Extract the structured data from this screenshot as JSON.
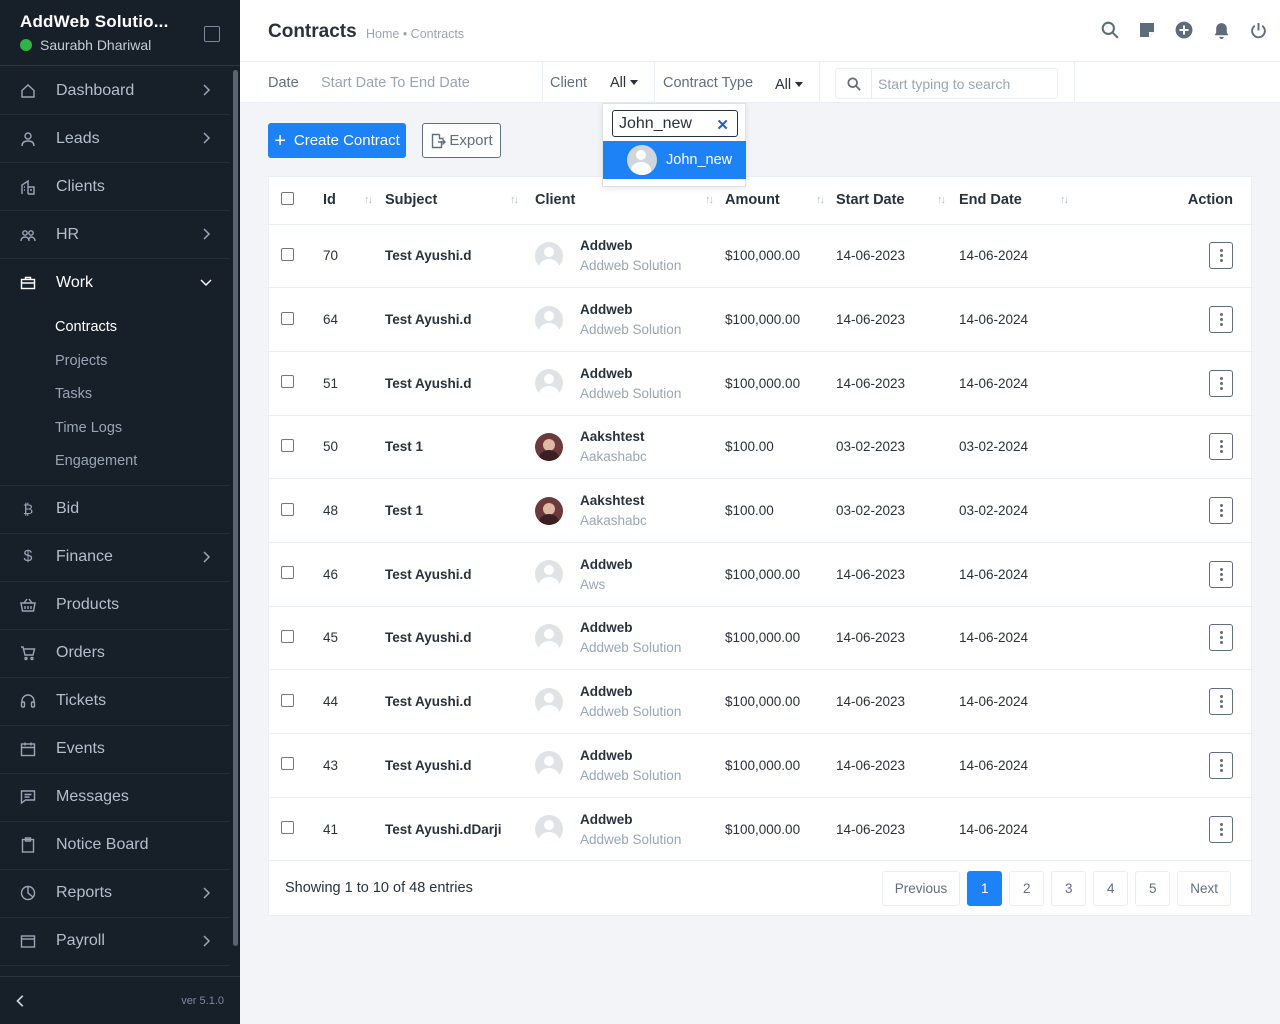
{
  "sidebar": {
    "brand": "AddWeb Solutio...",
    "user": "Saurabh Dhariwal",
    "version": "ver 5.1.0",
    "items": [
      {
        "label": "Dashboard",
        "icon": "house-icon"
      },
      {
        "label": "Leads",
        "icon": "user-icon"
      },
      {
        "label": "Clients",
        "icon": "building-icon"
      },
      {
        "label": "HR",
        "icon": "people-icon"
      },
      {
        "label": "Work",
        "icon": "briefcase-icon"
      },
      {
        "label": "Bid",
        "icon": "bitcoin-icon"
      },
      {
        "label": "Finance",
        "icon": "dollar-icon"
      },
      {
        "label": "Products",
        "icon": "basket-icon"
      },
      {
        "label": "Orders",
        "icon": "cart-icon"
      },
      {
        "label": "Tickets",
        "icon": "headset-icon"
      },
      {
        "label": "Events",
        "icon": "calendar-icon"
      },
      {
        "label": "Messages",
        "icon": "chat-icon"
      },
      {
        "label": "Notice Board",
        "icon": "clipboard-icon"
      },
      {
        "label": "Reports",
        "icon": "pie-chart-icon"
      },
      {
        "label": "Payroll",
        "icon": "wallet-icon"
      }
    ],
    "work_sub": [
      "Contracts",
      "Projects",
      "Tasks",
      "Time Logs",
      "Engagement"
    ]
  },
  "header": {
    "title": "Contracts",
    "breadcrumb": "Home • Contracts"
  },
  "filters": {
    "date_label": "Date",
    "date_placeholder": "Start Date To End Date",
    "client_label": "Client",
    "client_value": "All",
    "type_label": "Contract Type",
    "type_value": "All",
    "search_placeholder": "Start typing to search"
  },
  "dropdown": {
    "search_value": "John_new",
    "option": "John_new"
  },
  "actions": {
    "create": "Create Contract",
    "export": "Export"
  },
  "table": {
    "columns": [
      "Id",
      "Subject",
      "Client",
      "Amount",
      "Start Date",
      "End Date",
      "Action"
    ],
    "rows": [
      {
        "id": "70",
        "subject": "Test Ayushi.d",
        "client": "Addweb",
        "company": "Addweb Solution",
        "amount": "$100,000.00",
        "start": "14-06-2023",
        "end": "14-06-2024"
      },
      {
        "id": "64",
        "subject": "Test Ayushi.d",
        "client": "Addweb",
        "company": "Addweb Solution",
        "amount": "$100,000.00",
        "start": "14-06-2023",
        "end": "14-06-2024"
      },
      {
        "id": "51",
        "subject": "Test Ayushi.d",
        "client": "Addweb",
        "company": "Addweb Solution",
        "amount": "$100,000.00",
        "start": "14-06-2023",
        "end": "14-06-2024"
      },
      {
        "id": "50",
        "subject": "Test 1",
        "client": "Aakshtest",
        "company": "Aakashabc",
        "amount": "$100.00",
        "start": "03-02-2023",
        "end": "03-02-2024"
      },
      {
        "id": "48",
        "subject": "Test 1",
        "client": "Aakshtest",
        "company": "Aakashabc",
        "amount": "$100.00",
        "start": "03-02-2023",
        "end": "03-02-2024"
      },
      {
        "id": "46",
        "subject": "Test Ayushi.d",
        "client": "Addweb",
        "company": "Aws",
        "amount": "$100,000.00",
        "start": "14-06-2023",
        "end": "14-06-2024"
      },
      {
        "id": "45",
        "subject": "Test Ayushi.d",
        "client": "Addweb",
        "company": "Addweb Solution",
        "amount": "$100,000.00",
        "start": "14-06-2023",
        "end": "14-06-2024"
      },
      {
        "id": "44",
        "subject": "Test Ayushi.d",
        "client": "Addweb",
        "company": "Addweb Solution",
        "amount": "$100,000.00",
        "start": "14-06-2023",
        "end": "14-06-2024"
      },
      {
        "id": "43",
        "subject": "Test Ayushi.d",
        "client": "Addweb",
        "company": "Addweb Solution",
        "amount": "$100,000.00",
        "start": "14-06-2023",
        "end": "14-06-2024"
      },
      {
        "id": "41",
        "subject": "Test Ayushi.dDarji",
        "client": "Addweb",
        "company": "Addweb Solution",
        "amount": "$100,000.00",
        "start": "14-06-2023",
        "end": "14-06-2024"
      }
    ]
  },
  "footer": {
    "showing": "Showing 1 to 10 of 48 entries",
    "previous": "Previous",
    "pages": [
      "1",
      "2",
      "3",
      "4",
      "5"
    ],
    "next": "Next"
  },
  "colors": {
    "accent": "#1d82f5",
    "sidebar": "#171f29",
    "online": "#2fb344"
  }
}
